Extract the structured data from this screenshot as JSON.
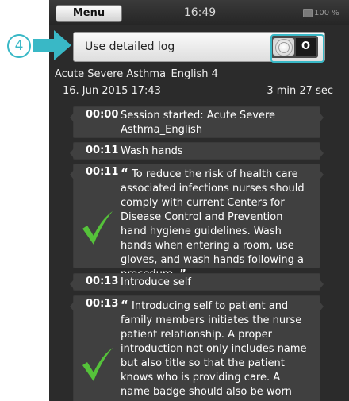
{
  "callout": {
    "number": "4"
  },
  "status_bar": {
    "menu_label": "Menu",
    "time": "16:49",
    "battery_text": "100 %"
  },
  "setting": {
    "label": "Use detailed log",
    "toggle_state": "O"
  },
  "scenario": {
    "title": "Acute Severe Asthma_English 4",
    "date": "16. Jun 2015 17:43",
    "duration": "3 min 27 sec"
  },
  "log": [
    {
      "time": "00:00",
      "text": "Session started: Acute Severe Asthma_English"
    },
    {
      "time": "00:11",
      "text": "Wash hands"
    },
    {
      "time": "00:11",
      "quote_open": "“",
      "text": "To reduce the risk of health care associated infections nurses should comply with current Centers for Disease Control and Prevention hand hygiene guidelines. Wash hands when entering a room, use gloves, and wash hands following a procedure.",
      "quote_close": "”",
      "icon": "check-icon"
    },
    {
      "time": "00:13",
      "text": "Introduce self"
    },
    {
      "time": "00:13",
      "quote_open": "“",
      "text": "Introducing self to patient and family members initiates the nurse patient relationship. A proper introduction not only includes name but also title so that the patient knows who is providing care. A name badge should also be worn visible to",
      "icon": "check-icon"
    }
  ],
  "colors": {
    "accent": "#39b8c6",
    "background": "#2b2b2b",
    "card": "#404040",
    "check": "#55c23a"
  }
}
